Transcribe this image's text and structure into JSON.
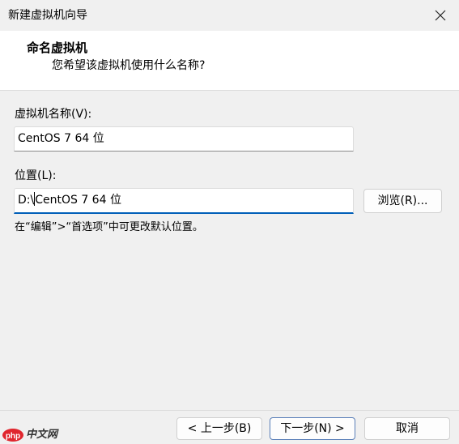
{
  "window": {
    "title": "新建虚拟机向导",
    "close_icon": "close-icon"
  },
  "header": {
    "title": "命名虚拟机",
    "subtitle": "您希望该虚拟机使用什么名称?"
  },
  "name_section": {
    "label": "虚拟机名称(V):",
    "value": "CentOS 7 64 位"
  },
  "location_section": {
    "label": "位置(L):",
    "value_prefix": "D:\\",
    "value_suffix": "CentOS 7 64 位",
    "browse_label": "浏览(R)..."
  },
  "hint": "在“编辑”>“首选项”中可更改默认位置。",
  "footer": {
    "back_label": "< 上一步(B)",
    "next_label": "下一步(N) >",
    "cancel_label": "取消"
  },
  "watermark": {
    "text": "中文网",
    "logo": "php",
    "color": "#e0262e"
  }
}
